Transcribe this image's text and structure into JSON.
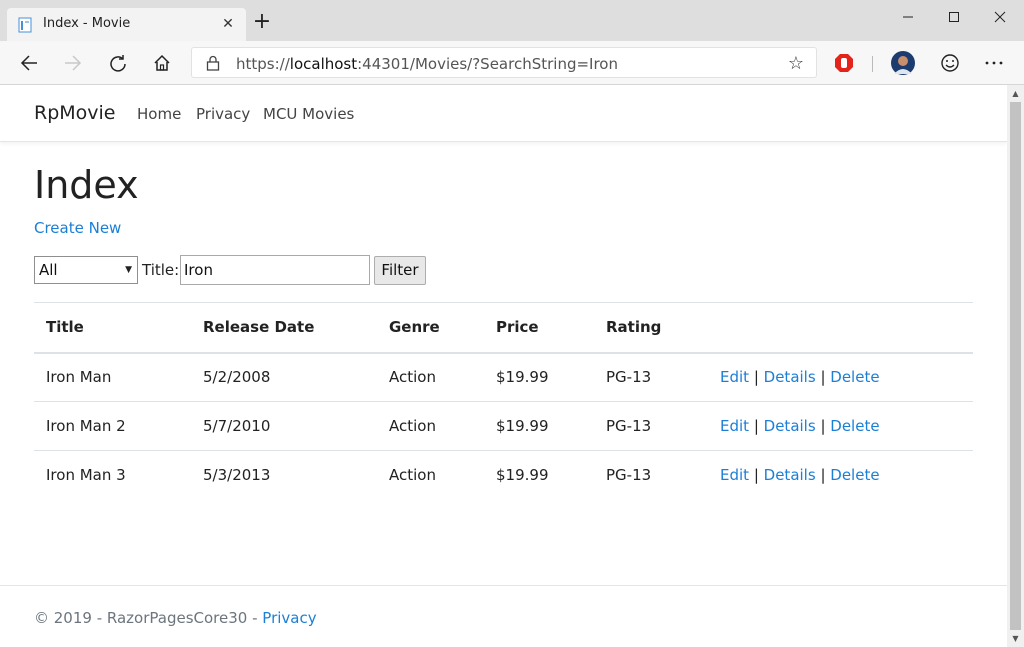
{
  "browser": {
    "tab_title": "Index - Movie",
    "tab_close": "✕",
    "new_tab": "+",
    "url_prefix": "https://",
    "url_host": "localhost",
    "url_rest": ":44301/Movies/?SearchString=Iron"
  },
  "site": {
    "brand": "RpMovie",
    "nav": [
      "Home",
      "Privacy",
      "MCU Movies"
    ]
  },
  "page": {
    "title": "Index",
    "create_new": "Create New"
  },
  "filter": {
    "genre_selected": "All",
    "title_label": "Title:",
    "title_value": "Iron",
    "button": "Filter"
  },
  "table": {
    "headers": [
      "Title",
      "Release Date",
      "Genre",
      "Price",
      "Rating"
    ],
    "rows": [
      {
        "title": "Iron Man",
        "date": "5/2/2008",
        "genre": "Action",
        "price": "$19.99",
        "rating": "PG-13"
      },
      {
        "title": "Iron Man 2",
        "date": "5/7/2010",
        "genre": "Action",
        "price": "$19.99",
        "rating": "PG-13"
      },
      {
        "title": "Iron Man 3",
        "date": "5/3/2013",
        "genre": "Action",
        "price": "$19.99",
        "rating": "PG-13"
      }
    ],
    "actions": {
      "edit": "Edit",
      "details": "Details",
      "delete": "Delete",
      "separator": " | "
    }
  },
  "footer": {
    "text": "© 2019 - RazorPagesCore30 - ",
    "link": "Privacy"
  },
  "colors": {
    "link": "#1b7fd6",
    "muted": "#6c757d"
  }
}
